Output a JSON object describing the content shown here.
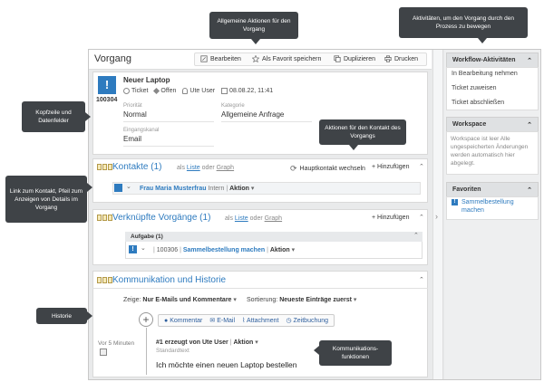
{
  "callouts": {
    "general_actions": "Allgemeine Aktionen für den Vorgang",
    "workflow_activities": "Aktivitäten, um den Vorgang durch den Prozess zu bewegen",
    "header_fields": "Kopfzeile und Datenfelder",
    "contact_actions": "Aktionen für den Kontakt des Vorgangs",
    "contact_link": "Link zum Kontakt, Pfeil zum Anzeigen von Details im Vorgang",
    "history": "Historie",
    "communication": "Kommunikations-funktionen"
  },
  "toolbar": {
    "title": "Vorgang",
    "edit": "Bearbeiten",
    "favorite": "Als Favorit speichern",
    "duplicate": "Duplizieren",
    "print": "Drucken"
  },
  "ticket": {
    "icon_char": "!",
    "number": "100304",
    "title": "Neuer Laptop",
    "type": "Ticket",
    "status": "Offen",
    "user": "Ute User",
    "date": "08.08.22, 11:41",
    "priority_label": "Priorität",
    "priority": "Normal",
    "category_label": "Kategorie",
    "category": "Allgemeine Anfrage",
    "channel_label": "Eingangskanal",
    "channel": "Email"
  },
  "contacts": {
    "title": "Kontakte (1)",
    "as": "als",
    "list": "Liste",
    "or": "oder",
    "graph": "Graph",
    "main_contact": "Hauptkontakt wechseln",
    "add": "Hinzufügen",
    "contact_name": "Frau Maria Musterfrau",
    "contact_tag": "Intern",
    "action": "Aktion"
  },
  "linked": {
    "title": "Verknüpfte Vorgänge (1)",
    "as": "als",
    "list": "Liste",
    "or": "oder",
    "graph": "Graph",
    "add": "Hinzufügen",
    "task_header": "Aufgabe (1)",
    "task_number": "100306",
    "task_name": "Sammelbestellung machen",
    "action": "Aktion"
  },
  "comm": {
    "title": "Kommunikation und Historie",
    "show_label": "Zeige:",
    "show_value": "Nur E-Mails und Kommentare",
    "sort_label": "Sortierung:",
    "sort_value": "Neueste Einträge zuerst",
    "btn_comment": "Kommentar",
    "btn_email": "E-Mail",
    "btn_attachment": "Attachment",
    "btn_time": "Zeitbuchung",
    "time_ago": "Vor 5 Minuten",
    "entry_head": "#1 erzeugt von Ute User",
    "entry_action": "Aktion",
    "entry_sub": "Standardtext",
    "entry_text": "Ich möchte einen neuen Laptop bestellen"
  },
  "sidebar": {
    "workflow_title": "Workflow-Aktivitäten",
    "workflow_items": [
      "In Bearbeitung nehmen",
      "Ticket zuweisen",
      "Ticket abschließen"
    ],
    "workspace_title": "Workspace",
    "workspace_text": "Workspace ist leer Alle ungespeicherten Änderungen werden automatisch hier abgelegt.",
    "favorites_title": "Favoriten",
    "favorite_item": "Sammelbestellung machen"
  },
  "colors": {
    "accent": "#2e7bbf",
    "callout": "#3f4347"
  }
}
